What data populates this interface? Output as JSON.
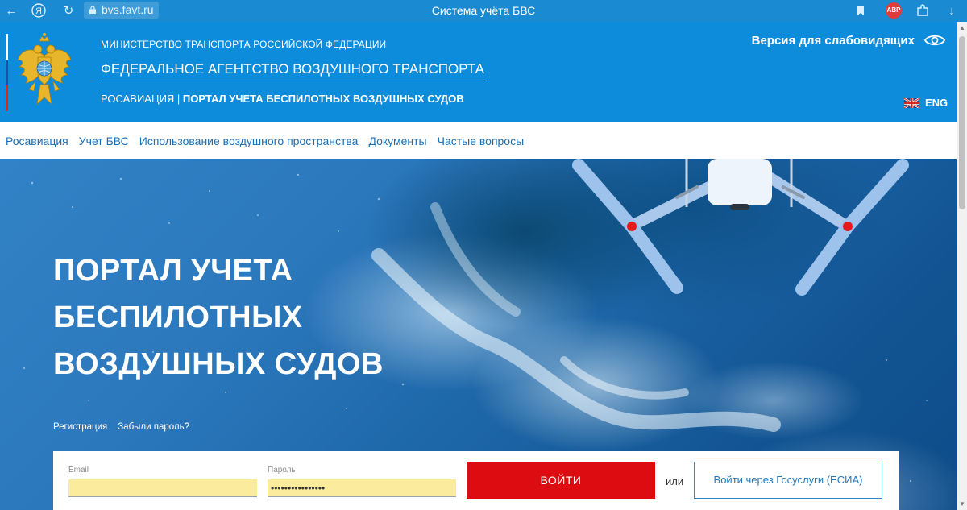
{
  "browser": {
    "url": "bvs.favt.ru",
    "tab_title": "Система учёта БВС",
    "abp_label": "ABP",
    "icons": [
      "back-arrow-icon",
      "yandex-icon",
      "reload-icon",
      "lock-icon",
      "bookmark-icon",
      "adblock-icon",
      "extension-icon",
      "download-icon"
    ]
  },
  "header": {
    "ministry": "МИНИСТЕРСТВО ТРАНСПОРТА РОССИЙСКОЙ ФЕДЕРАЦИИ",
    "agency": "ФЕДЕРАЛЬНОЕ АГЕНТСТВО ВОЗДУШНОГО ТРАНСПОРТА",
    "portal_prefix": "РОСАВИАЦИЯ | ",
    "portal_name": "ПОРТАЛ УЧЕТА БЕСПИЛОТНЫХ ВОЗДУШНЫХ СУДОВ",
    "accessibility": "Версия для слабовидящих",
    "lang": "ENG"
  },
  "nav": {
    "items": [
      {
        "label": "Росавиация"
      },
      {
        "label": "Учет БВС"
      },
      {
        "label": "Использование воздушного пространства"
      },
      {
        "label": "Документы"
      },
      {
        "label": "Частые вопросы"
      }
    ]
  },
  "hero": {
    "title_line1": "ПОРТАЛ УЧЕТА",
    "title_line2": "БЕСПИЛОТНЫХ",
    "title_line3": "ВОЗДУШНЫХ СУДОВ",
    "register_link": "Регистрация",
    "forgot_link": "Забыли пароль?"
  },
  "login": {
    "email_label": "Email",
    "email_value": "",
    "password_label": "Пароль",
    "password_value": "••••••••••••••••",
    "submit_label": "ВОЙТИ",
    "or_label": "или",
    "esia_label": "Войти через Госуслуги (ЕСИА)"
  },
  "colors": {
    "header_bg": "#0d8cdc",
    "nav_link": "#1b6fb3",
    "primary_button": "#dc0c10",
    "autofill": "#fbeb9d"
  }
}
